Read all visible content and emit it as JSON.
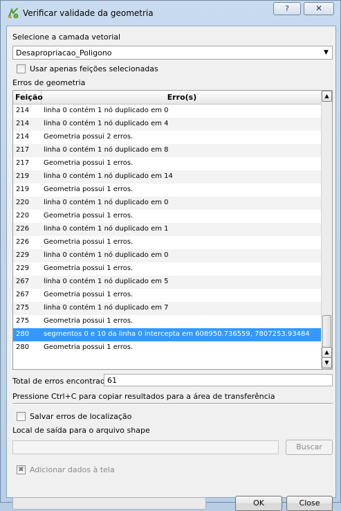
{
  "window": {
    "title": "Verificar validade da geometria",
    "help_label": "?",
    "close_label": "✕"
  },
  "layer": {
    "label": "Selecione a camada vetorial",
    "selected": "Desapropriacao_Poligono"
  },
  "only_selected": {
    "label": "Usar apenas feições selecionadas",
    "checked": false
  },
  "errors": {
    "section_label": "Erros de geometria",
    "col_feature": "Feição",
    "col_errors": "Erro(s)",
    "rows": [
      {
        "f": "214",
        "e": "linha 0 contém 1 nó duplicado em 0"
      },
      {
        "f": "214",
        "e": "linha 0 contém 1 nó duplicado em 4"
      },
      {
        "f": "214",
        "e": "Geometria possui 2 erros."
      },
      {
        "f": "217",
        "e": "linha 0 contém 1 nó duplicado em 8"
      },
      {
        "f": "217",
        "e": "Geometria possui 1 erros."
      },
      {
        "f": "219",
        "e": "linha 0 contém 1 nó duplicado em 14"
      },
      {
        "f": "219",
        "e": "Geometria possui 1 erros."
      },
      {
        "f": "220",
        "e": "linha 0 contém 1 nó duplicado em 0"
      },
      {
        "f": "220",
        "e": "Geometria possui 1 erros."
      },
      {
        "f": "226",
        "e": "linha 0 contém 1 nó duplicado em 1"
      },
      {
        "f": "226",
        "e": "Geometria possui 1 erros."
      },
      {
        "f": "229",
        "e": "linha 0 contém 1 nó duplicado em 0"
      },
      {
        "f": "229",
        "e": "Geometria possui 1 erros."
      },
      {
        "f": "267",
        "e": "linha 0 contém 1 nó duplicado em 5"
      },
      {
        "f": "267",
        "e": "Geometria possui 1 erros."
      },
      {
        "f": "275",
        "e": "linha 0 contém 1 nó duplicado em 7"
      },
      {
        "f": "275",
        "e": "Geometria possui 1 erros."
      },
      {
        "f": "280",
        "e": "segmentos 0 e 10 da linha 0 intercepta em 608950.736559, 7807253.93484",
        "selected": true
      },
      {
        "f": "280",
        "e": "Geometria possui 1 erros."
      }
    ]
  },
  "total": {
    "label": "Total de erros encontrados",
    "value": "61"
  },
  "clipboard_hint": "Pressione Ctrl+C para copiar resultados para a área de transferência",
  "save_errors": {
    "label": "Salvar erros de localização",
    "checked": false
  },
  "output": {
    "label": "Local de saída para o arquivo shape",
    "value": "",
    "browse_label": "Buscar"
  },
  "add_to_canvas": {
    "label": "Adicionar dados à tela",
    "checked": true,
    "enabled": false
  },
  "buttons": {
    "ok": "OK",
    "close": "Close"
  },
  "colors": {
    "selection": "#3399ff",
    "window_frame": "#b9cfe6"
  },
  "icons": {
    "title": "qgis-check-geometry-icon"
  }
}
